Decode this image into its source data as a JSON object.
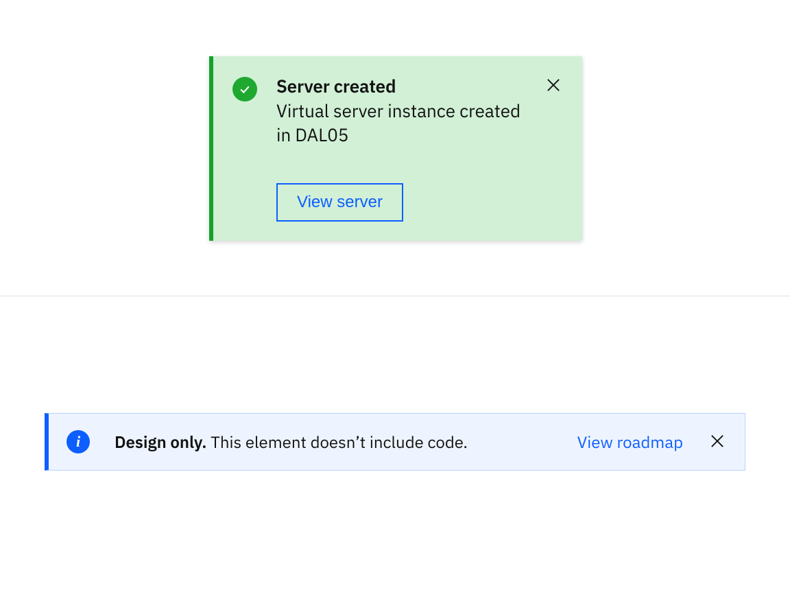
{
  "toast": {
    "status": "success",
    "title": "Server created",
    "description": "Virtual server instance created in DAL05",
    "action_label": "View server",
    "icon": "checkmark-icon",
    "close_icon": "close-icon",
    "accent_color": "#15a22b",
    "background_color": "#d1f0d6"
  },
  "inline": {
    "status": "info",
    "title_bold": "Design only.",
    "message": " This element doesn’t include code.",
    "link_label": "View roadmap",
    "icon": "info-icon",
    "close_icon": "close-icon",
    "accent_color": "#0d5eff",
    "background_color": "#eef4ff"
  }
}
